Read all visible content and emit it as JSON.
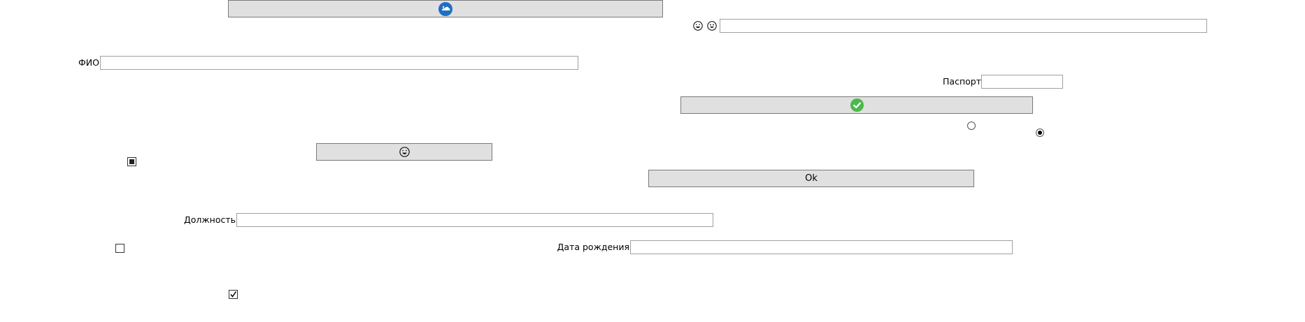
{
  "buttons": {
    "top_icon_button": {
      "icon": "cloud-badge-icon",
      "accent": "#1e6fc2"
    },
    "check_button": {
      "icon": "check-circle-icon",
      "accent": "#4cb84c"
    },
    "emoji_button": {
      "icon": "grinning-face-icon"
    },
    "ok_button": {
      "label": "Ok"
    }
  },
  "emoji_row": {
    "icons": [
      "laughing-face-icon",
      "smiling-face-icon"
    ]
  },
  "fields": {
    "fio": {
      "label": "ФИО",
      "value": ""
    },
    "passport": {
      "label": "Паспорт",
      "value": ""
    },
    "position": {
      "label": "Должность",
      "value": ""
    },
    "birth_date": {
      "label": "Дата рождения",
      "value": ""
    },
    "top_right": {
      "value": ""
    }
  },
  "checkboxes": {
    "indeterminate": {
      "state": "indeterminate"
    },
    "unchecked": {
      "state": "unchecked"
    },
    "checked": {
      "state": "checked"
    }
  },
  "radios": {
    "option_a": {
      "selected": false
    },
    "option_b": {
      "selected": true
    }
  }
}
